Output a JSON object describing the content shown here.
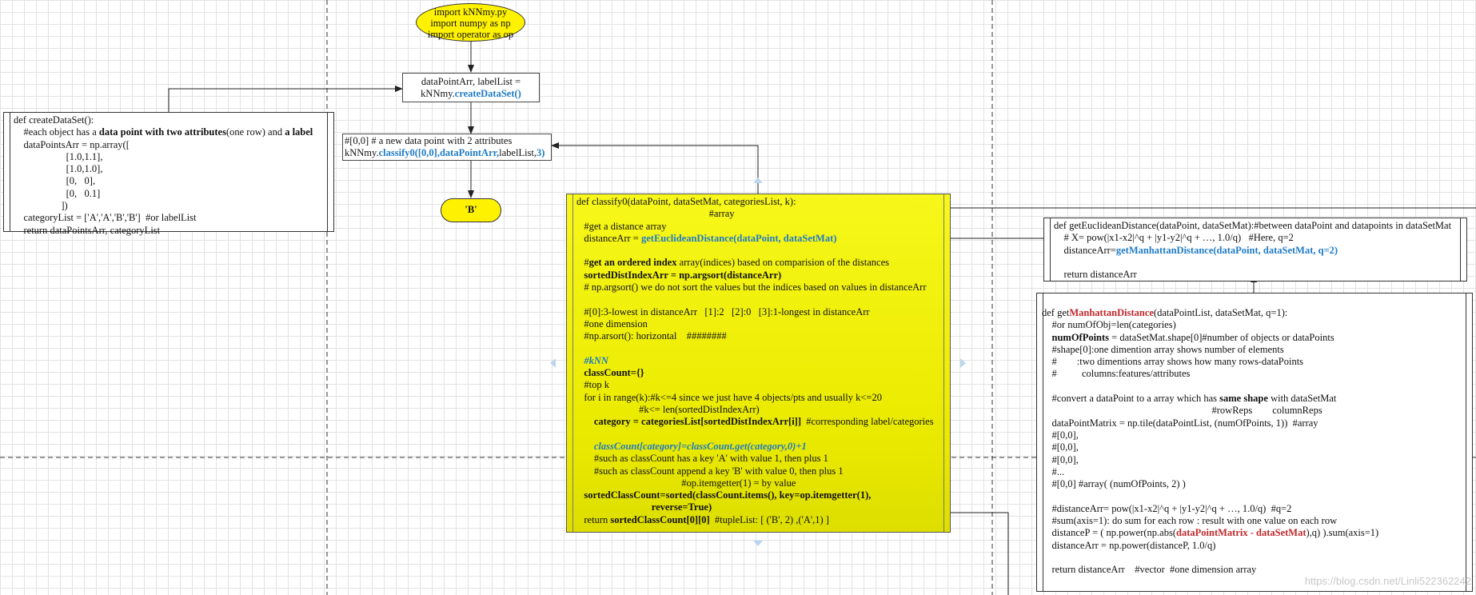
{
  "colors": {
    "shape_fill": "#fff200",
    "code_blue": "#1f7bc5",
    "code_red": "#c0282b",
    "grid": "#e3e3e3"
  },
  "start_node": {
    "lines": [
      "import kNNmy.py",
      "import numpy as np",
      "import operator as op"
    ]
  },
  "load_step": {
    "lines": [
      [
        {
          "t": "dataPointArr, labelList ="
        }
      ],
      [
        {
          "t": "kNNmy."
        },
        {
          "t": "createDataSet()",
          "s": "blue"
        }
      ]
    ]
  },
  "classify_call": {
    "lines": [
      [
        {
          "t": "#[0,0] # a new data point with 2 attributes"
        }
      ],
      [
        {
          "t": "kNNmy."
        },
        {
          "t": "classify0([0,0],dataPointArr,",
          "s": "blue"
        },
        {
          "t": "labelList,"
        },
        {
          "t": "3)",
          "s": "blue"
        }
      ]
    ]
  },
  "end_node": {
    "label": "'B'"
  },
  "create_dataset": {
    "lines": [
      [
        {
          "t": "def createDataSet():"
        }
      ],
      [
        {
          "t": "    #each object has a "
        },
        {
          "t": "data point with two attributes",
          "s": "b"
        },
        {
          "t": "(one row) and "
        },
        {
          "t": "a label",
          "s": "b"
        }
      ],
      [
        {
          "t": "    dataPointsArr = np.array(["
        }
      ],
      [
        {
          "t": "                     [1.0,1.1],"
        }
      ],
      [
        {
          "t": "                     [1.0,1.0],"
        }
      ],
      [
        {
          "t": "                     [0,   0],"
        }
      ],
      [
        {
          "t": "                     [0,   0.1]"
        }
      ],
      [
        {
          "t": "                   ])"
        }
      ],
      [
        {
          "t": "    categoryList = ['A','A','B','B']  #or labelList"
        }
      ],
      [
        {
          "t": "    return dataPointsArr, categoryList"
        }
      ]
    ]
  },
  "classify_def": {
    "lines": [
      [
        {
          "t": "def classify0(dataPoint, dataSetMat, categoriesList, k):"
        }
      ],
      [
        {
          "t": "                                                     #array"
        }
      ],
      [
        {
          "t": "   #get a distance array"
        }
      ],
      [
        {
          "t": "   distanceArr = "
        },
        {
          "t": "getEuclideanDistance(dataPoint, dataSetMat)",
          "s": "blue"
        }
      ],
      [
        {
          "t": ""
        }
      ],
      [
        {
          "t": "   #"
        },
        {
          "t": "get an ordered index",
          "s": "b"
        },
        {
          "t": " array(indices) based on comparision of the distances"
        }
      ],
      [
        {
          "t": "   sortedDistIndexArr = np.argsort(distanceArr)",
          "s": "b"
        }
      ],
      [
        {
          "t": "   # np.argsort() we do not sort the values but the indices based on values in distanceArr"
        }
      ],
      [
        {
          "t": ""
        }
      ],
      [
        {
          "t": "   #[0]:3-lowest in distanceArr   [1]:2   [2]:0   [3]:1-longest in distanceArr"
        }
      ],
      [
        {
          "t": "   #one dimension"
        }
      ],
      [
        {
          "t": "   #np.arsort(): horizontal    ########"
        }
      ],
      [
        {
          "t": ""
        }
      ],
      [
        {
          "t": "   "
        },
        {
          "t": "#kNN",
          "s": "blue ital"
        }
      ],
      [
        {
          "t": "   classCount={}",
          "s": "b"
        }
      ],
      [
        {
          "t": "   #top k"
        }
      ],
      [
        {
          "t": "   for i in range(k):#k<=4 since we just have 4 objects/pts and usually k<=20"
        }
      ],
      [
        {
          "t": "                         #k<= len(sortedDistIndexArr)"
        }
      ],
      [
        {
          "t": "       "
        },
        {
          "t": "category = categoriesList[sortedDistIndexArr[i]]",
          "s": "b"
        },
        {
          "t": "  #corresponding label/categories"
        }
      ],
      [
        {
          "t": ""
        }
      ],
      [
        {
          "t": "       "
        },
        {
          "t": "classCount[category]=classCount.get(category,0)+1",
          "s": "blue ital"
        }
      ],
      [
        {
          "t": "       #such as classCount has a key 'A' with value 1, then plus 1"
        }
      ],
      [
        {
          "t": "       #such as classCount append a key 'B' with value 0, then plus 1"
        }
      ],
      [
        {
          "t": "                                          #op.itemgetter(1) = by value"
        }
      ],
      [
        {
          "t": "   sortedClassCount=sorted(classCount.items(), key=op.itemgetter(1),",
          "s": "b"
        }
      ],
      [
        {
          "t": "                              reverse=True)",
          "s": "b"
        }
      ],
      [
        {
          "t": "   return "
        },
        {
          "t": "sortedClassCount[0][0]",
          "s": "b"
        },
        {
          "t": "  #tupleList: [ ('B', 2) ,('A',1) ]"
        }
      ]
    ]
  },
  "euclid_def": {
    "lines": [
      [
        {
          "t": "def getEuclideanDistance(dataPoint, dataSetMat):#between dataPoint and datapoints in dataSetMat"
        }
      ],
      [
        {
          "t": "    # X= pow(|x1-x2|^q + |y1-y2|^q + …, 1.0/q)   #Here, q=2"
        }
      ],
      [
        {
          "t": "    distanceArr="
        },
        {
          "t": "getManhattanDistance(dataPoint, dataSetMat, q=2)",
          "s": "blue"
        }
      ],
      [
        {
          "t": ""
        }
      ],
      [
        {
          "t": "    return distanceArr"
        }
      ]
    ]
  },
  "manhattan_def": {
    "lines": [
      [
        {
          "t": "def get"
        },
        {
          "t": "ManhattanDistance",
          "s": "red"
        },
        {
          "t": "(dataPointList, dataSetMat, q=1):"
        }
      ],
      [
        {
          "t": "    #or numOfObj=len(categories)"
        }
      ],
      [
        {
          "t": "    "
        },
        {
          "t": "numOfPoints",
          "s": "b"
        },
        {
          "t": " = dataSetMat.shape[0]#number of objects or dataPoints"
        }
      ],
      [
        {
          "t": "    #shape[0]:one dimention array shows number of elements"
        }
      ],
      [
        {
          "t": "    #        :two dimentions array shows how many rows-dataPoints"
        }
      ],
      [
        {
          "t": "    #          columns:features/attributes"
        }
      ],
      [
        {
          "t": ""
        }
      ],
      [
        {
          "t": "    #convert a dataPoint to a array which has "
        },
        {
          "t": "same shape",
          "s": "b"
        },
        {
          "t": " with dataSetMat"
        }
      ],
      [
        {
          "t": "                                                                    #rowReps        columnReps"
        }
      ],
      [
        {
          "t": "    dataPointMatrix = np.tile(dataPointList, (numOfPoints, 1))  #array"
        }
      ],
      [
        {
          "t": "    #[0,0],"
        }
      ],
      [
        {
          "t": "    #[0,0],"
        }
      ],
      [
        {
          "t": "    #[0,0],"
        }
      ],
      [
        {
          "t": "    #..."
        }
      ],
      [
        {
          "t": "    #[0,0] #array( (numOfPoints, 2) )"
        }
      ],
      [
        {
          "t": ""
        }
      ],
      [
        {
          "t": "    #distanceArr= pow(|x1-x2|^q + |y1-y2|^q + …, 1.0/q)  #q=2"
        }
      ],
      [
        {
          "t": "    #sum(axis=1): do sum for each row : result with one value on each row"
        }
      ],
      [
        {
          "t": "    distanceP = ( np.power(np.abs("
        },
        {
          "t": "dataPointMatrix - dataSetMat",
          "s": "red"
        },
        {
          "t": "),q) ).sum(axis=1)"
        }
      ],
      [
        {
          "t": "    distanceArr = np.power(distanceP, 1.0/q)"
        }
      ],
      [
        {
          "t": ""
        }
      ],
      [
        {
          "t": "    return distanceArr    #vector  #one dimension array"
        }
      ]
    ]
  },
  "watermark": "https://blog.csdn.net/Linli522362242"
}
